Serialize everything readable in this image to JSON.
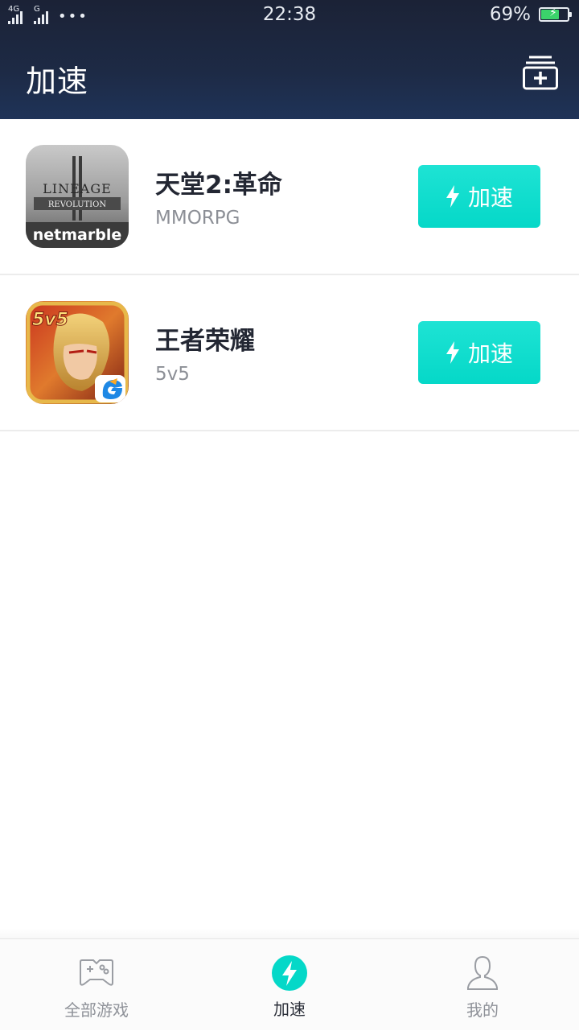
{
  "status_bar": {
    "network_1": "4G",
    "network_2": "G",
    "more_dots": "•••",
    "time": "22:38",
    "battery_percent": "69%",
    "battery_level": 0.69,
    "charging": true
  },
  "header": {
    "title": "加速",
    "add_icon": "add-game-icon"
  },
  "games": [
    {
      "name": "天堂2:革命",
      "genre": "MMORPG",
      "icon": "lineage2-revolution-icon",
      "icon_text_top": "LINEAGE",
      "icon_text_mid": "REVOLUTION",
      "icon_text_brand": "netmarble",
      "button_label": "加速"
    },
    {
      "name": "王者荣耀",
      "genre": "5v5",
      "icon": "honor-of-kings-icon",
      "icon_text_badge": "5v5",
      "button_label": "加速"
    }
  ],
  "tabbar": {
    "tabs": [
      {
        "label": "全部游戏",
        "icon": "gamepad-icon",
        "active": false
      },
      {
        "label": "加速",
        "icon": "lightning-icon",
        "active": true
      },
      {
        "label": "我的",
        "icon": "user-icon",
        "active": false
      }
    ]
  },
  "colors": {
    "accent": "#05d8c8",
    "header_bg": "#1d2a45",
    "text_primary": "#232733",
    "text_secondary": "#8c8f96"
  }
}
